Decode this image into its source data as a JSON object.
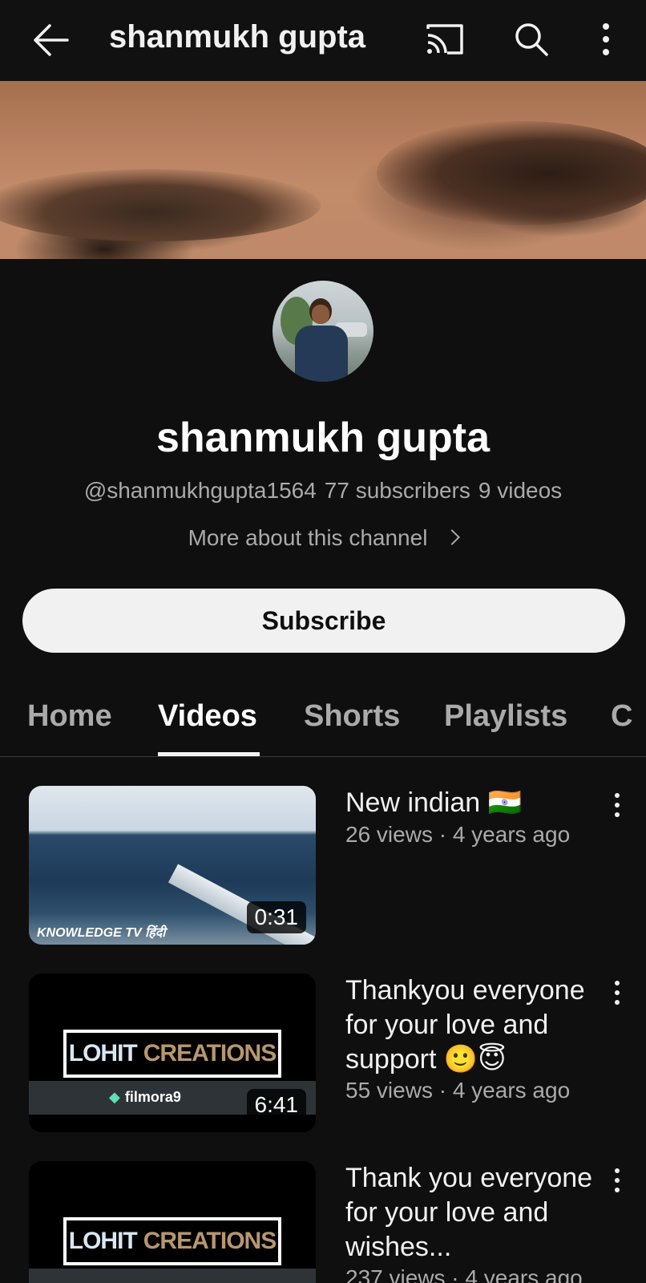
{
  "topbar": {
    "title": "shanmukh gupta"
  },
  "channel": {
    "name": "shanmukh gupta",
    "handle": "@shanmukhgupta1564",
    "subscribers": "77 subscribers",
    "videos_count": "9 videos",
    "more_about": "More about this channel",
    "subscribe_label": "Subscribe"
  },
  "tabs": [
    {
      "label": "Home"
    },
    {
      "label": "Videos",
      "active": true
    },
    {
      "label": "Shorts"
    },
    {
      "label": "Playlists"
    },
    {
      "label": "C"
    }
  ],
  "videos": [
    {
      "title": "New indian 🇮🇳",
      "meta": "26 views · 4 years ago",
      "duration": "0:31",
      "thumb_text": "KNOWLEDGE TV हिंदी"
    },
    {
      "title": "Thankyou everyone for your love and support 🙂😇",
      "meta": "55 views · 4 years ago",
      "duration": "6:41",
      "thumb_text_a": "LOHIT",
      "thumb_text_b": "CREATIONS",
      "watermark": "filmora9"
    },
    {
      "title": "Thank you everyone for your love and wishes...",
      "meta": "237 views · 4 years ago",
      "thumb_text_a": "LOHIT",
      "thumb_text_b": "CREATIONS"
    }
  ],
  "colors": {
    "background": "#0f0f0f",
    "text": "#f1f1f1",
    "secondary": "#aaaaaa",
    "button": "#f1f1f1"
  },
  "icons": [
    "back-arrow-icon",
    "cast-icon",
    "search-icon",
    "more-vert-icon",
    "chevron-right-icon"
  ]
}
